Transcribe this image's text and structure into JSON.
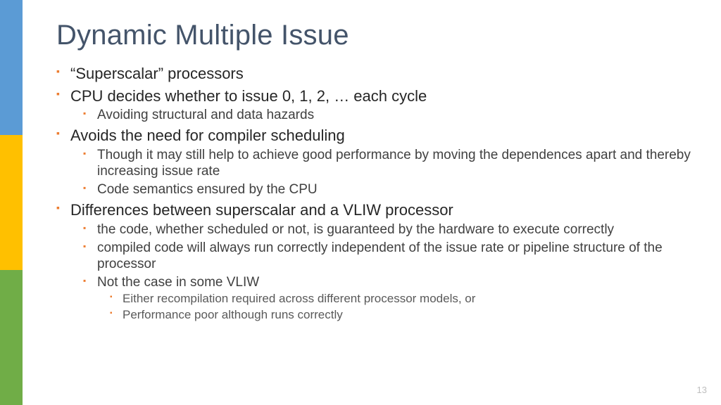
{
  "title": "Dynamic Multiple Issue",
  "bullets": [
    {
      "text": "“Superscalar” processors"
    },
    {
      "text": "CPU decides whether to issue 0, 1, 2, … each cycle",
      "sub": [
        {
          "text": "Avoiding structural and data hazards"
        }
      ]
    },
    {
      "text": "Avoids the need for compiler scheduling",
      "sub": [
        {
          "text": "Though it may still help to achieve good performance by moving the dependences apart and thereby increasing issue rate"
        },
        {
          "text": "Code semantics ensured by the CPU"
        }
      ]
    },
    {
      "text": "Differences between superscalar and a VLIW processor",
      "sub": [
        {
          "text": "the code, whether scheduled or not, is guaranteed by the hardware to execute correctly"
        },
        {
          "text": "compiled code will always run correctly independent of the issue rate or pipeline structure of the processor"
        },
        {
          "text": "Not the case in some VLIW",
          "sub": [
            {
              "text": "Either recompilation required across different processor models, or"
            },
            {
              "text": "Performance poor although runs correctly"
            }
          ]
        }
      ]
    }
  ],
  "page_number": "13"
}
